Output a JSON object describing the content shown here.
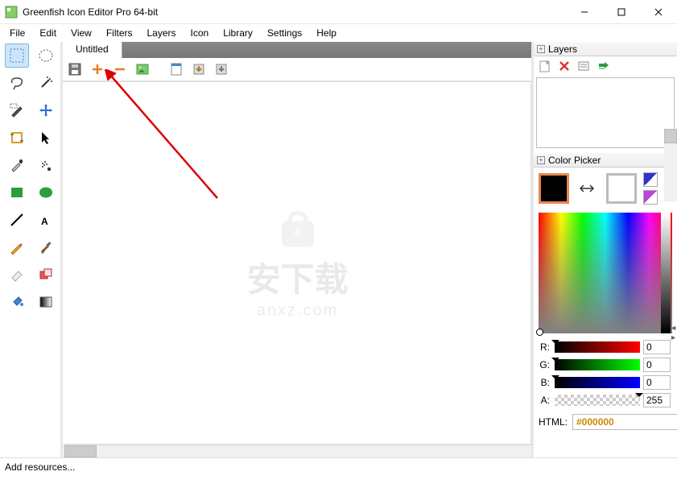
{
  "title": "Greenfish Icon Editor Pro 64-bit",
  "menus": [
    "File",
    "Edit",
    "View",
    "Filters",
    "Layers",
    "Icon",
    "Library",
    "Settings",
    "Help"
  ],
  "tab": "Untitled",
  "layers_label": "Layers",
  "color_picker_label": "Color Picker",
  "rgba_labels": {
    "r": "R:",
    "g": "G:",
    "b": "B:",
    "a": "A:"
  },
  "rgba": {
    "r": "0",
    "g": "0",
    "b": "0",
    "a": "255"
  },
  "html_label": "HTML:",
  "html_value": "#000000",
  "status": "Add resources...",
  "watermark_a": "安下载",
  "watermark_b": "anxz.com",
  "colors": {
    "fg": "#000000",
    "bg": "#ffffff"
  }
}
